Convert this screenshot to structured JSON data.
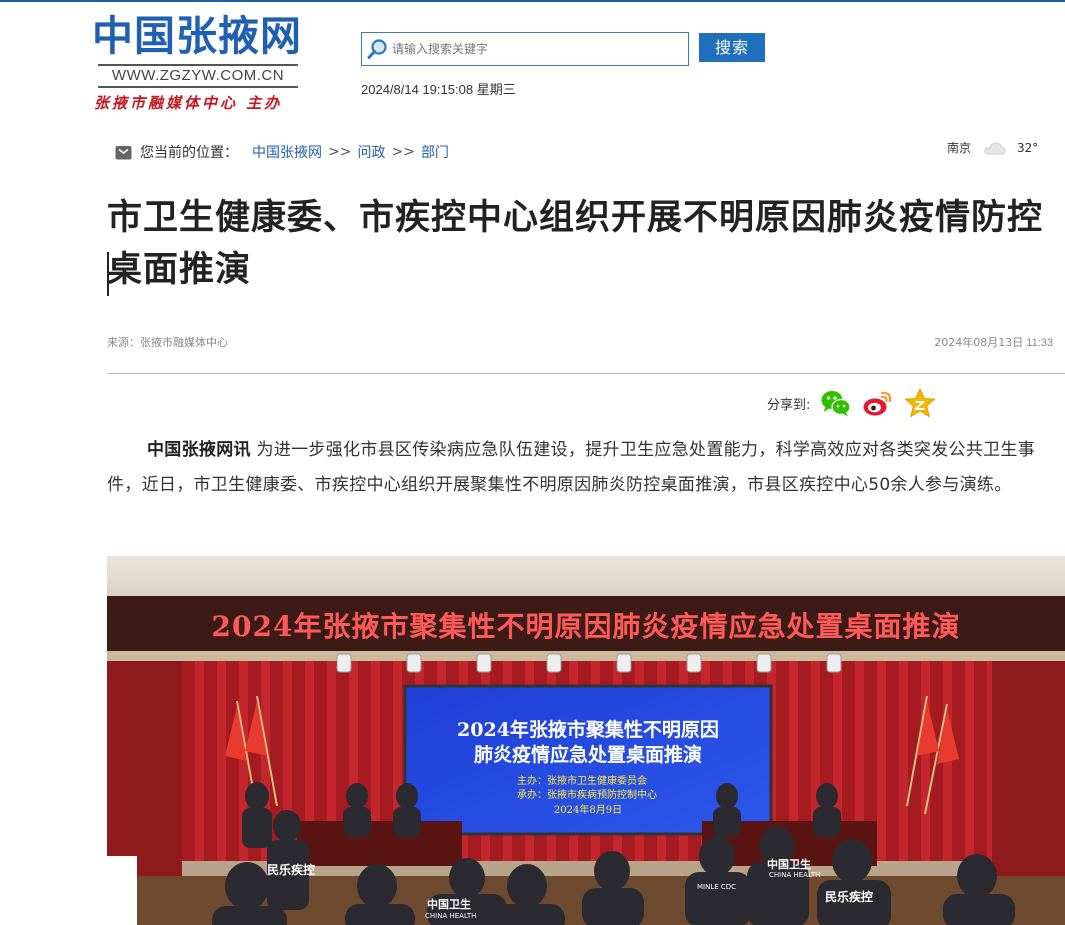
{
  "header": {
    "logo_cn": "中国张掖网",
    "logo_url": "WWW.ZGZYW.COM.CN",
    "logo_sub": "张掖市融媒体中心 主办",
    "search_placeholder": "请输入搜索关键字",
    "search_button": "搜索",
    "datetime": "2024/8/14 19:15:08",
    "weekday": "星期三"
  },
  "breadcrumb": {
    "prefix": "您当前的位置：",
    "items": [
      "中国张掖网",
      "问政",
      "部门"
    ],
    "separator": ">>"
  },
  "weather": {
    "city": "南京",
    "temp": "32°",
    "icon": "cloud-icon"
  },
  "article": {
    "title": "市卫生健康委、市疾控中心组织开展不明原因肺炎疫情防控桌面推演",
    "source": "来源：张掖市融媒体中心",
    "date": "2024年08月13日",
    "time": "11:33",
    "share_label": "分享到:",
    "share_icons": [
      "wechat-icon",
      "weibo-icon",
      "qzone-icon"
    ],
    "lead": "中国张掖网讯",
    "body": "为进一步强化市县区传染病应急队伍建设，提升卫生应急处置能力，科学高效应对各类突发公共卫生事件，近日，市卫生健康委、市疾控中心组织开展聚集性不明原因肺炎防控桌面推演，市县区疾控中心50余人参与演练。"
  },
  "photo": {
    "banner": "2024年张掖市聚集性不明原因肺炎疫情应急处置桌面推演",
    "screen_line1": "2024年张掖市聚集性不明原因",
    "screen_line2": "肺炎疫情应急处置桌面推演",
    "host": "主办：张掖市卫生健康委员会",
    "organizer": "承办：张掖市疾病预防控制中心",
    "date": "2024年8月9日",
    "vest_labels": [
      "民乐疾控",
      "中国卫生",
      "CHINA HEALTH",
      "MINLE CDC",
      "CHINA HEALTH",
      "中国卫生",
      "民乐疾控"
    ]
  },
  "colors": {
    "brand_blue": "#1f5fb4",
    "brand_red": "#c8161d",
    "button_blue": "#1f6fbd"
  }
}
